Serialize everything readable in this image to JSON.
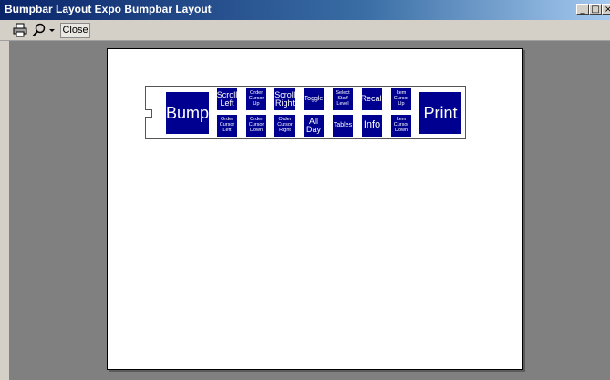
{
  "window": {
    "title": "Bumpbar Layout Expo Bumpbar Layout",
    "controls": {
      "minimize": "_",
      "maximize": "□",
      "close": "×"
    }
  },
  "toolbar": {
    "print_icon": "printer-icon",
    "zoom_icon": "magnifier-icon",
    "dropdown_icon": "chevron-down-icon",
    "close_label": "Close"
  },
  "bumpbar": {
    "keys": {
      "bump": "Bump",
      "scroll_left": "Scroll Left",
      "order_cursor_up": "Order Cursor Up",
      "scroll_right": "Scroll Right",
      "toggle": "Toggle",
      "select_staff_level": "Select Staff Level",
      "recall": "Recall",
      "item_cursor_up": "Item Cursor Up",
      "print": "Print",
      "order_cursor_left": "Order Cursor Left",
      "order_cursor_down": "Order Cursor Down",
      "order_cursor_right": "Order Cursor Right",
      "all_day": "All Day",
      "tables": "Tables",
      "info": "Info",
      "item_cursor_down": "Item Cursor Down"
    },
    "key_color": "#000090"
  }
}
